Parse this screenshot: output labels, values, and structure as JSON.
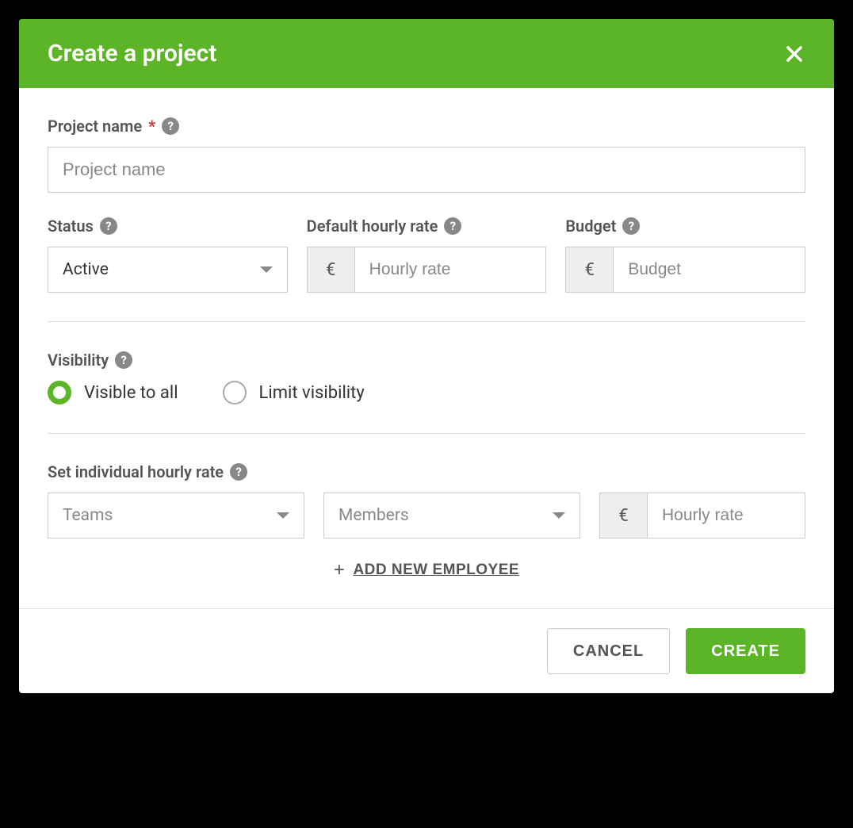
{
  "modal": {
    "title": "Create a project"
  },
  "projectName": {
    "label": "Project name",
    "placeholder": "Project name",
    "required": "*"
  },
  "status": {
    "label": "Status",
    "value": "Active"
  },
  "hourlyRate": {
    "label": "Default hourly rate",
    "currency": "€",
    "placeholder": "Hourly rate"
  },
  "budget": {
    "label": "Budget",
    "currency": "€",
    "placeholder": "Budget"
  },
  "visibility": {
    "label": "Visibility",
    "option1": "Visible to all",
    "option2": "Limit visibility"
  },
  "individualRate": {
    "label": "Set individual hourly rate",
    "teamsPlaceholder": "Teams",
    "membersPlaceholder": "Members",
    "currency": "€",
    "ratePlaceholder": "Hourly rate"
  },
  "addEmployee": "ADD NEW EMPLOYEE",
  "footer": {
    "cancel": "CANCEL",
    "create": "CREATE"
  }
}
